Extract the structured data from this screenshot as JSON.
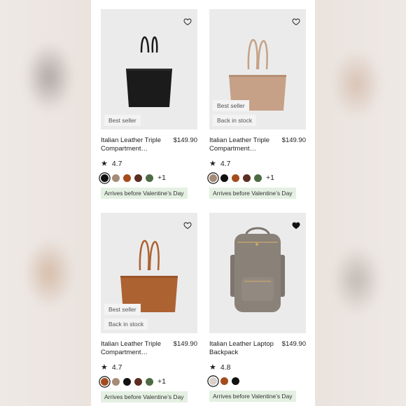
{
  "products": [
    {
      "name": "Italian Leather Triple Compartment…",
      "price": "$149.90",
      "rating": "4.7",
      "tags": [
        "Best seller"
      ],
      "more": "+1",
      "arrival": "Arrives before Valentine’s Day",
      "favorited": false,
      "swatches": [
        "#111111",
        "#a58b78",
        "#a54c1e",
        "#5b2e22",
        "#4e6b45"
      ],
      "selected_swatch": 0,
      "bag_color": "#1b1b1b",
      "type": "tote"
    },
    {
      "name": "Italian Leather Triple Compartment…",
      "price": "$149.90",
      "rating": "4.7",
      "tags": [
        "Best seller",
        "Back in stock"
      ],
      "more": "+1",
      "arrival": "Arrives before Valentine’s Day",
      "favorited": false,
      "swatches": [
        "#a58b78",
        "#111111",
        "#a54c1e",
        "#5b2e22",
        "#4e6b45"
      ],
      "selected_swatch": 0,
      "bag_color": "#c6a187",
      "type": "tote"
    },
    {
      "name": "Italian Leather Triple Compartment…",
      "price": "$149.90",
      "rating": "4.7",
      "tags": [
        "Best seller",
        "Back in stock"
      ],
      "more": "+1",
      "arrival": "Arrives before Valentine’s Day",
      "favorited": false,
      "swatches": [
        "#a54c1e",
        "#a58b78",
        "#111111",
        "#5b2e22",
        "#4e6b45"
      ],
      "selected_swatch": 0,
      "bag_color": "#ad6232",
      "type": "tote"
    },
    {
      "name": "Italian Leather Laptop Backpack",
      "price": "$149.90",
      "rating": "4.8",
      "tags": [],
      "more": "",
      "arrival": "Arrives before Valentine’s Day",
      "favorited": true,
      "swatches": [
        "#d9d0c8",
        "#a54c1e",
        "#111111"
      ],
      "selected_swatch": 0,
      "bag_color": "#8a8178",
      "type": "backpack"
    }
  ],
  "colors": {
    "image_bg": "#ebebeb",
    "arrival_bg": "#e4f0e2",
    "tag_bg": "#f3f3f3"
  },
  "icons": {
    "favorite": "heart-icon",
    "rating": "star-icon"
  }
}
